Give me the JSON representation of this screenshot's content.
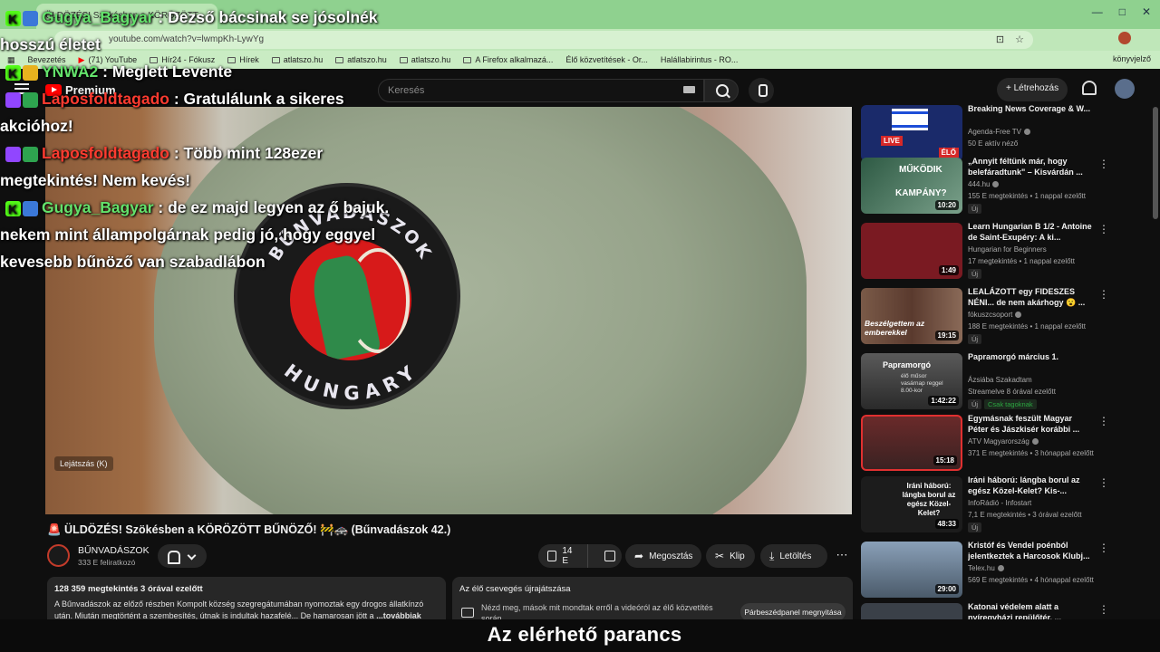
{
  "browser": {
    "tab_title": "ÜLDÖZÉS! Szökésben a KÖRÖZÖTT",
    "url": "youtube.com/watch?v=lwmpKh-LywYg",
    "bookmarks": [
      "Bevezetés",
      "(71) YouTube",
      "Hír24 - Fókusz",
      "Hírek",
      "atlatszo.hu",
      "atlatszo.hu",
      "atlatszo.hu",
      "A Firefox alkalmazá...",
      "Élő közvetítések - Or...",
      "Halállabirintus - RO..."
    ],
    "other_bookmarks": "könyvjelző"
  },
  "youtube": {
    "logo_text": "Premium",
    "search_placeholder": "Keresés",
    "create_label": "Létrehozás"
  },
  "chat_overlay": [
    {
      "nick": "Gugya_Bagyar",
      "sep": " :",
      "text": "Dezső bácsinak se jósolnék hosszú életet",
      "nick_color": "#63e26b",
      "platform": "kick"
    },
    {
      "nick": "YNWA2",
      "sep": " :",
      "text": "Meglett Levente",
      "nick_color": "#63e26b",
      "platform": "kick"
    },
    {
      "nick": "Laposfoldtagado",
      "sep": " :",
      "text": "Gratulálunk a sikeres akcióhoz!",
      "nick_color": "#ff3b30",
      "platform": "twitch"
    },
    {
      "nick": "Laposfoldtagado",
      "sep": " :",
      "text": "Több mint 128ezer megtekintés! Nem kevés!",
      "nick_color": "#ff3b30",
      "platform": "twitch"
    },
    {
      "nick": "Gugya_Bagyar",
      "sep": " :",
      "text": "de ez majd legyen az ő bajuk. nekem mint állampolgárnak pedig jó, hogy eggyel kevesebb bűnöző van szabadlábon",
      "nick_color": "#63e26b",
      "platform": "kick"
    }
  ],
  "player": {
    "watermark": "Lejátszás (K)",
    "badge_top": "BŰNVADÁSZOK",
    "badge_bottom": "HUNGARY"
  },
  "video": {
    "title": "🚨 ÜLDÖZÉS! Szökésben a KÖRÖZÖTT BŰNÖZŐ! 🚧🚓 (Bűnvadászok 42.)",
    "channel": "BŰNVADÁSZOK",
    "subscribers": "333 E feliratkozó",
    "likes": "14 E",
    "share": "Megosztás",
    "clip": "Klip",
    "download": "Letöltés",
    "stats": "128 359 megtekintés  3 órával ezelőtt",
    "description": "A Bűnvadászok az előző részben Kompolt község szegregátumában nyomoztak egy drogos állatkínzó után. Miután megtörtént a szembesítés, útnak is indultak hazafelé... De hamarosan jött a",
    "more": "...továbbiak"
  },
  "chat_replay": {
    "title": "Az élő csevegés újrajátszása",
    "text": "Nézd meg, mások mit mondtak erről a videóról az élő közvetítés során.",
    "button": "Párbeszédpanel megnyitása"
  },
  "recommendations": [
    {
      "title": "Breaking News Coverage & W...",
      "channel": "Agenda-Free TV",
      "meta": "50 E aktív néző",
      "badge": "",
      "member": "",
      "duration": "",
      "thumb_color": "#1a2a6a"
    },
    {
      "title": "„Annyit féltünk már, hogy belefáradtunk\" – Kisvárdán ...",
      "channel": "444.hu",
      "meta": "155 E megtekintés • 1 nappal ezelőtt",
      "badge": "Új",
      "member": "",
      "duration": "10:20",
      "thumb_color": "#2b4a3a"
    },
    {
      "title": "Learn Hungarian B 1/2 - Antoine de Saint-Exupéry: A ki...",
      "channel": "Hungarian for Beginners",
      "meta": "17 megtekintés • 1 nappal ezelőtt",
      "badge": "Új",
      "member": "",
      "duration": "1:49",
      "thumb_color": "#7a1a22"
    },
    {
      "title": "LEALÁZOTT egy FIDESZES NÉNI... de nem akárhogy 😮 ...",
      "channel": "fókuszcsoport",
      "meta": "188 E megtekintés • 1 nappal ezelőtt",
      "badge": "Új",
      "member": "",
      "duration": "19:15",
      "thumb_color": "#6a4a3a"
    },
    {
      "title": "Papramorgó március 1.",
      "channel": "Ázsiába Szakadtam",
      "meta": "Streamelve 8 órával ezelőtt",
      "badge": "Új",
      "member": "Csak tagoknak",
      "duration": "1:42:22",
      "thumb_color": "#3a3a3a"
    },
    {
      "title": "Egymásnak feszült Magyar Péter és Jászkisér korábbi ...",
      "channel": "ATV Magyarország",
      "meta": "371 E megtekintés • 3 hónappal ezelőtt",
      "badge": "",
      "member": "",
      "duration": "15:18",
      "thumb_color": "#5a2a2a"
    },
    {
      "title": "Iráni háború: lángba borul az egész Közel-Kelet? Kis-...",
      "channel": "InfoRádió - Infostart",
      "meta": "7,1 E megtekintés • 3 órával ezelőtt",
      "badge": "Új",
      "member": "",
      "duration": "48:33",
      "thumb_color": "#1c1c1c"
    },
    {
      "title": "Kristóf és Vendel poénból jelentkeztek a Harcosok Klubj...",
      "channel": "Telex.hu",
      "meta": "569 E megtekintés • 4 hónappal ezelőtt",
      "badge": "",
      "member": "",
      "duration": "29:00",
      "thumb_color": "#4a5a6a"
    },
    {
      "title": "Katonai védelem alatt a nyíregyházi repülőtér, ...",
      "channel": "",
      "meta": "",
      "badge": "",
      "member": "",
      "duration": "",
      "thumb_color": "#3a4048"
    }
  ],
  "thumb_texts": {
    "rec0_live": "LIVE",
    "rec0_elo": "ÉLŐ",
    "rec1_top": "MŰKÖDIK",
    "rec1_bottom": "KAMPÁNY?",
    "rec3_text": "Beszélgettem az emberekkel",
    "rec4_top": "Papramorgó",
    "rec4_sub": "élő műsor vasárnap reggel 8.00-kor",
    "rec6_text": "Iráni háború: lángba borul az egész Közel-Kelet?"
  },
  "caption": "Az elérhető parancs",
  "colors": {
    "accent_red": "#ff0000",
    "chat_green": "#63e26b",
    "chat_red": "#ff3b30",
    "kick_green": "#53fc18",
    "twitch_purple": "#9146ff"
  }
}
